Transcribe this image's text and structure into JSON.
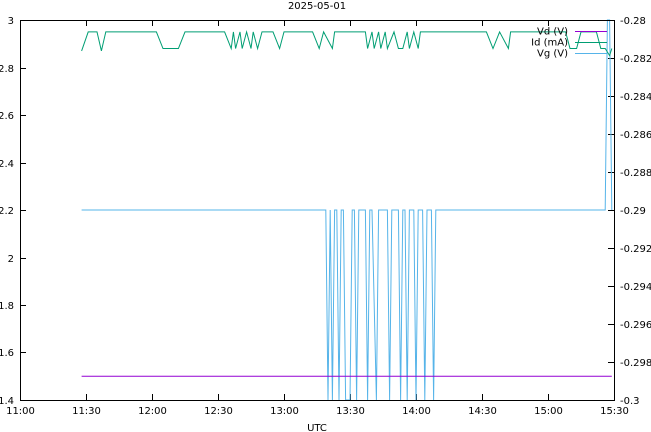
{
  "chart_data": {
    "type": "line",
    "title": "2025-05-01",
    "xlabel": "UTC",
    "x_range": [
      "11:00",
      "15:30"
    ],
    "x_ticks": [
      "11:00",
      "11:30",
      "12:00",
      "12:30",
      "13:00",
      "13:30",
      "14:00",
      "14:30",
      "15:00",
      "15:30"
    ],
    "y_left": {
      "range": [
        1.4,
        3.0
      ],
      "ticks": [
        "1.4",
        "1.6",
        "1.8",
        "2",
        "2.2",
        "2.4",
        "2.6",
        "2.8",
        "3"
      ]
    },
    "y_right": {
      "range": [
        -0.3,
        -0.28
      ],
      "ticks": [
        "-0.3",
        "-0.298",
        "-0.296",
        "-0.294",
        "-0.292",
        "-0.29",
        "-0.288",
        "-0.286",
        "-0.284",
        "-0.282",
        "-0.28"
      ]
    },
    "legend_position": "top-right",
    "series": [
      {
        "name": "Vd (V)",
        "axis": "left",
        "color": "#9400d3",
        "points": [
          [
            "11:28",
            1.5
          ],
          [
            "15:29",
            1.5
          ]
        ]
      },
      {
        "name": "Id (mA)",
        "axis": "left",
        "color": "#009e73",
        "points": [
          [
            "11:28",
            2.87
          ],
          [
            "11:31",
            2.95
          ],
          [
            "11:35",
            2.95
          ],
          [
            "11:37",
            2.87
          ],
          [
            "11:39",
            2.95
          ],
          [
            "11:43",
            2.95
          ],
          [
            "11:47",
            2.95
          ],
          [
            "11:51",
            2.95
          ],
          [
            "11:55",
            2.95
          ],
          [
            "12:02",
            2.95
          ],
          [
            "12:05",
            2.88
          ],
          [
            "12:12",
            2.88
          ],
          [
            "12:15",
            2.95
          ],
          [
            "12:19",
            2.95
          ],
          [
            "12:24",
            2.95
          ],
          [
            "12:28",
            2.95
          ],
          [
            "12:33",
            2.95
          ],
          [
            "12:36",
            2.88
          ],
          [
            "12:37",
            2.95
          ],
          [
            "12:38",
            2.88
          ],
          [
            "12:40",
            2.95
          ],
          [
            "12:41",
            2.88
          ],
          [
            "12:43",
            2.95
          ],
          [
            "12:45",
            2.88
          ],
          [
            "12:46",
            2.95
          ],
          [
            "12:48",
            2.88
          ],
          [
            "12:50",
            2.95
          ],
          [
            "12:55",
            2.95
          ],
          [
            "12:58",
            2.88
          ],
          [
            "13:00",
            2.95
          ],
          [
            "13:05",
            2.95
          ],
          [
            "13:08",
            2.95
          ],
          [
            "13:13",
            2.95
          ],
          [
            "13:16",
            2.88
          ],
          [
            "13:18",
            2.95
          ],
          [
            "13:22",
            2.88
          ],
          [
            "13:23",
            2.95
          ],
          [
            "13:28",
            2.95
          ],
          [
            "13:32",
            2.95
          ],
          [
            "13:37",
            2.95
          ],
          [
            "13:38",
            2.88
          ],
          [
            "13:40",
            2.95
          ],
          [
            "13:41",
            2.88
          ],
          [
            "13:43",
            2.95
          ],
          [
            "13:44",
            2.88
          ],
          [
            "13:46",
            2.95
          ],
          [
            "13:47",
            2.88
          ],
          [
            "13:50",
            2.95
          ],
          [
            "13:52",
            2.88
          ],
          [
            "13:54",
            2.88
          ],
          [
            "13:56",
            2.95
          ],
          [
            "13:57",
            2.88
          ],
          [
            "13:59",
            2.95
          ],
          [
            "14:01",
            2.88
          ],
          [
            "14:02",
            2.95
          ],
          [
            "14:08",
            2.95
          ],
          [
            "14:12",
            2.95
          ],
          [
            "14:18",
            2.95
          ],
          [
            "14:22",
            2.95
          ],
          [
            "14:25",
            2.95
          ],
          [
            "14:28",
            2.95
          ],
          [
            "14:32",
            2.95
          ],
          [
            "14:35",
            2.88
          ],
          [
            "14:38",
            2.95
          ],
          [
            "14:42",
            2.88
          ],
          [
            "14:43",
            2.95
          ],
          [
            "14:45",
            2.95
          ],
          [
            "14:52",
            2.95
          ],
          [
            "14:58",
            2.95
          ],
          [
            "15:05",
            2.95
          ],
          [
            "15:08",
            2.95
          ],
          [
            "15:10",
            2.88
          ],
          [
            "15:13",
            2.88
          ],
          [
            "15:15",
            2.95
          ],
          [
            "15:22",
            2.95
          ],
          [
            "15:24",
            2.88
          ],
          [
            "15:26",
            2.88
          ],
          [
            "15:28",
            2.85
          ],
          [
            "15:29",
            2.88
          ]
        ]
      },
      {
        "name": "Vg (V)",
        "axis": "right",
        "color": "#56b4e9",
        "points": [
          [
            "11:28",
            -0.29
          ],
          [
            "13:19",
            -0.29
          ],
          [
            "13:20",
            -0.3
          ],
          [
            "13:21",
            -0.29
          ],
          [
            "13:22",
            -0.3
          ],
          [
            "13:23",
            -0.29
          ],
          [
            "13:24",
            -0.29
          ],
          [
            "13:25",
            -0.3
          ],
          [
            "13:26",
            -0.29
          ],
          [
            "13:27",
            -0.29
          ],
          [
            "13:28",
            -0.3
          ],
          [
            "13:30",
            -0.3
          ],
          [
            "13:31",
            -0.29
          ],
          [
            "13:32",
            -0.29
          ],
          [
            "13:33",
            -0.3
          ],
          [
            "13:34",
            -0.29
          ],
          [
            "13:37",
            -0.29
          ],
          [
            "13:38",
            -0.3
          ],
          [
            "13:39",
            -0.29
          ],
          [
            "13:40",
            -0.29
          ],
          [
            "13:42",
            -0.3
          ],
          [
            "13:43",
            -0.29
          ],
          [
            "13:47",
            -0.29
          ],
          [
            "13:48",
            -0.3
          ],
          [
            "13:49",
            -0.29
          ],
          [
            "13:52",
            -0.29
          ],
          [
            "13:53",
            -0.3
          ],
          [
            "13:54",
            -0.29
          ],
          [
            "13:55",
            -0.29
          ],
          [
            "13:56",
            -0.3
          ],
          [
            "13:57",
            -0.29
          ],
          [
            "13:59",
            -0.29
          ],
          [
            "14:00",
            -0.3
          ],
          [
            "14:01",
            -0.29
          ],
          [
            "14:03",
            -0.29
          ],
          [
            "14:04",
            -0.3
          ],
          [
            "14:05",
            -0.29
          ],
          [
            "14:07",
            -0.29
          ],
          [
            "14:08",
            -0.3
          ],
          [
            "14:09",
            -0.29
          ],
          [
            "15:26",
            -0.29
          ],
          [
            "15:27",
            -0.28
          ],
          [
            "15:28",
            -0.28
          ],
          [
            "15:29",
            -0.29
          ]
        ]
      }
    ]
  }
}
